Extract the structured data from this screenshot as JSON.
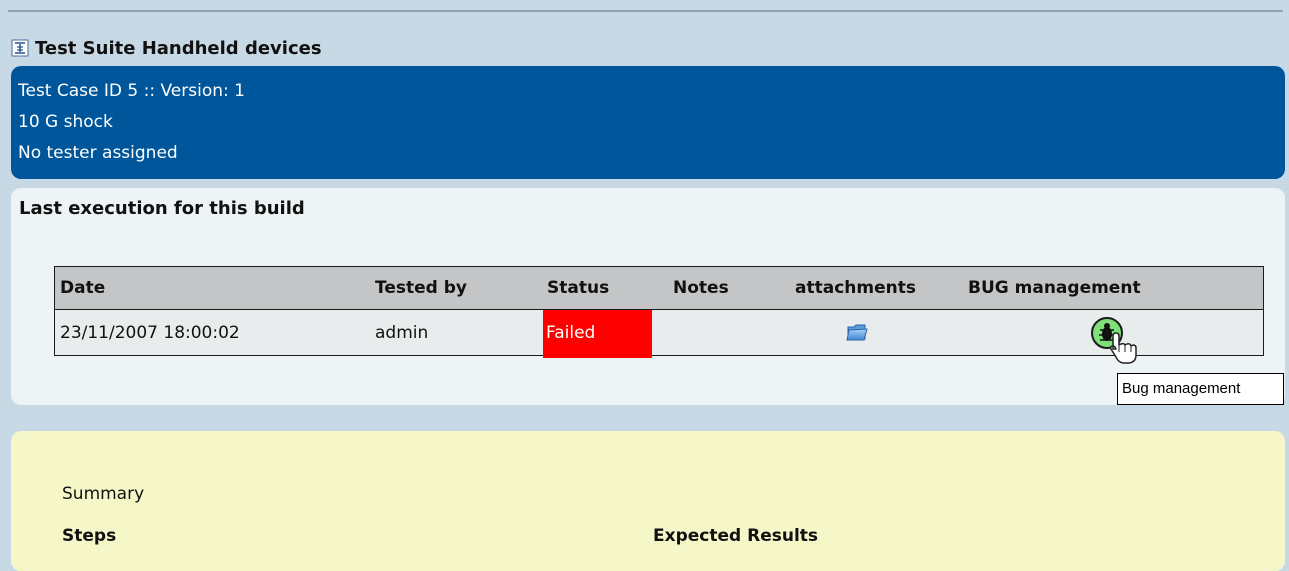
{
  "suite": {
    "title": "Test Suite Handheld devices",
    "icon": "test-suite-icon"
  },
  "test_case": {
    "id_line": "Test Case ID 5 :: Version: 1",
    "name": "10 G shock",
    "tester": "No tester assigned"
  },
  "execution": {
    "title": "Last execution for this build",
    "columns": [
      "Date",
      "Tested by",
      "Status",
      "Notes",
      "attachments",
      "BUG management"
    ],
    "row": {
      "date": "23/11/2007 18:00:02",
      "tested_by": "admin",
      "status": "Failed",
      "notes": "",
      "attachments_icon": "folder-icon",
      "bug_icon": "bug-management-icon"
    },
    "status_color": "#ff0000"
  },
  "tooltip": {
    "text": "Bug management"
  },
  "spec": {
    "summary_label": "Summary",
    "steps_label": "Steps",
    "expected_label": "Expected Results"
  },
  "colors": {
    "header_bg": "#00569a",
    "page_bg": "#c8d9e6",
    "spec_bg": "#f5f7c8"
  }
}
